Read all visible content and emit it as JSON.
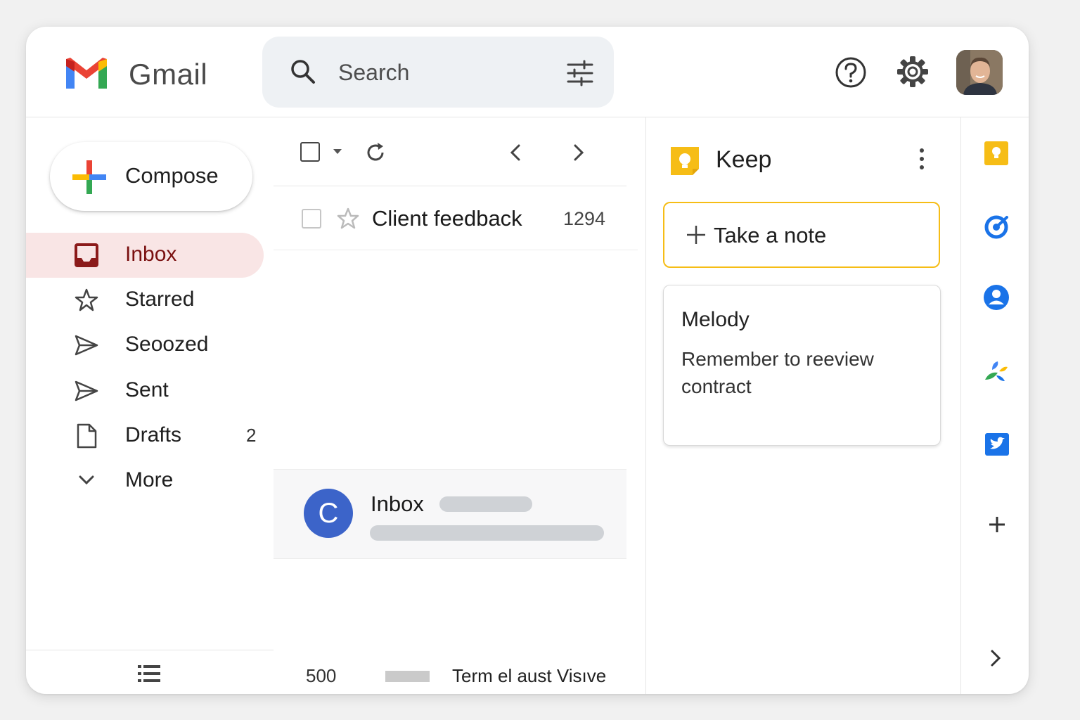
{
  "header": {
    "brand": "Gmail",
    "search_placeholder": "Search"
  },
  "compose": {
    "label": "Compose"
  },
  "nav": [
    {
      "label": "Inbox",
      "icon": "inbox-icon",
      "active": true
    },
    {
      "label": "Starred",
      "icon": "star-icon"
    },
    {
      "label": "Seoozed",
      "icon": "send-icon"
    },
    {
      "label": "Sent",
      "icon": "send-icon"
    },
    {
      "label": "Drafts",
      "icon": "draft-icon",
      "count": "2"
    },
    {
      "label": "More",
      "icon": "chevron-down-icon"
    }
  ],
  "mail_list": {
    "rows": [
      {
        "subject": "Client feedback",
        "count": "1294"
      }
    ],
    "preview": {
      "avatar_letter": "C",
      "title": "Inbox"
    },
    "footer": {
      "number": "500",
      "link": "Term el aust Visıve"
    }
  },
  "keep": {
    "title": "Keep",
    "take_note": "Take a note",
    "note": {
      "title": "Melody",
      "body": "Remember to reeview contract"
    }
  },
  "colors": {
    "active_bg": "#f9e5e5",
    "active_text": "#7a1010",
    "keep_yellow": "#f6bd16",
    "avatar_blue": "#3c64c9"
  }
}
